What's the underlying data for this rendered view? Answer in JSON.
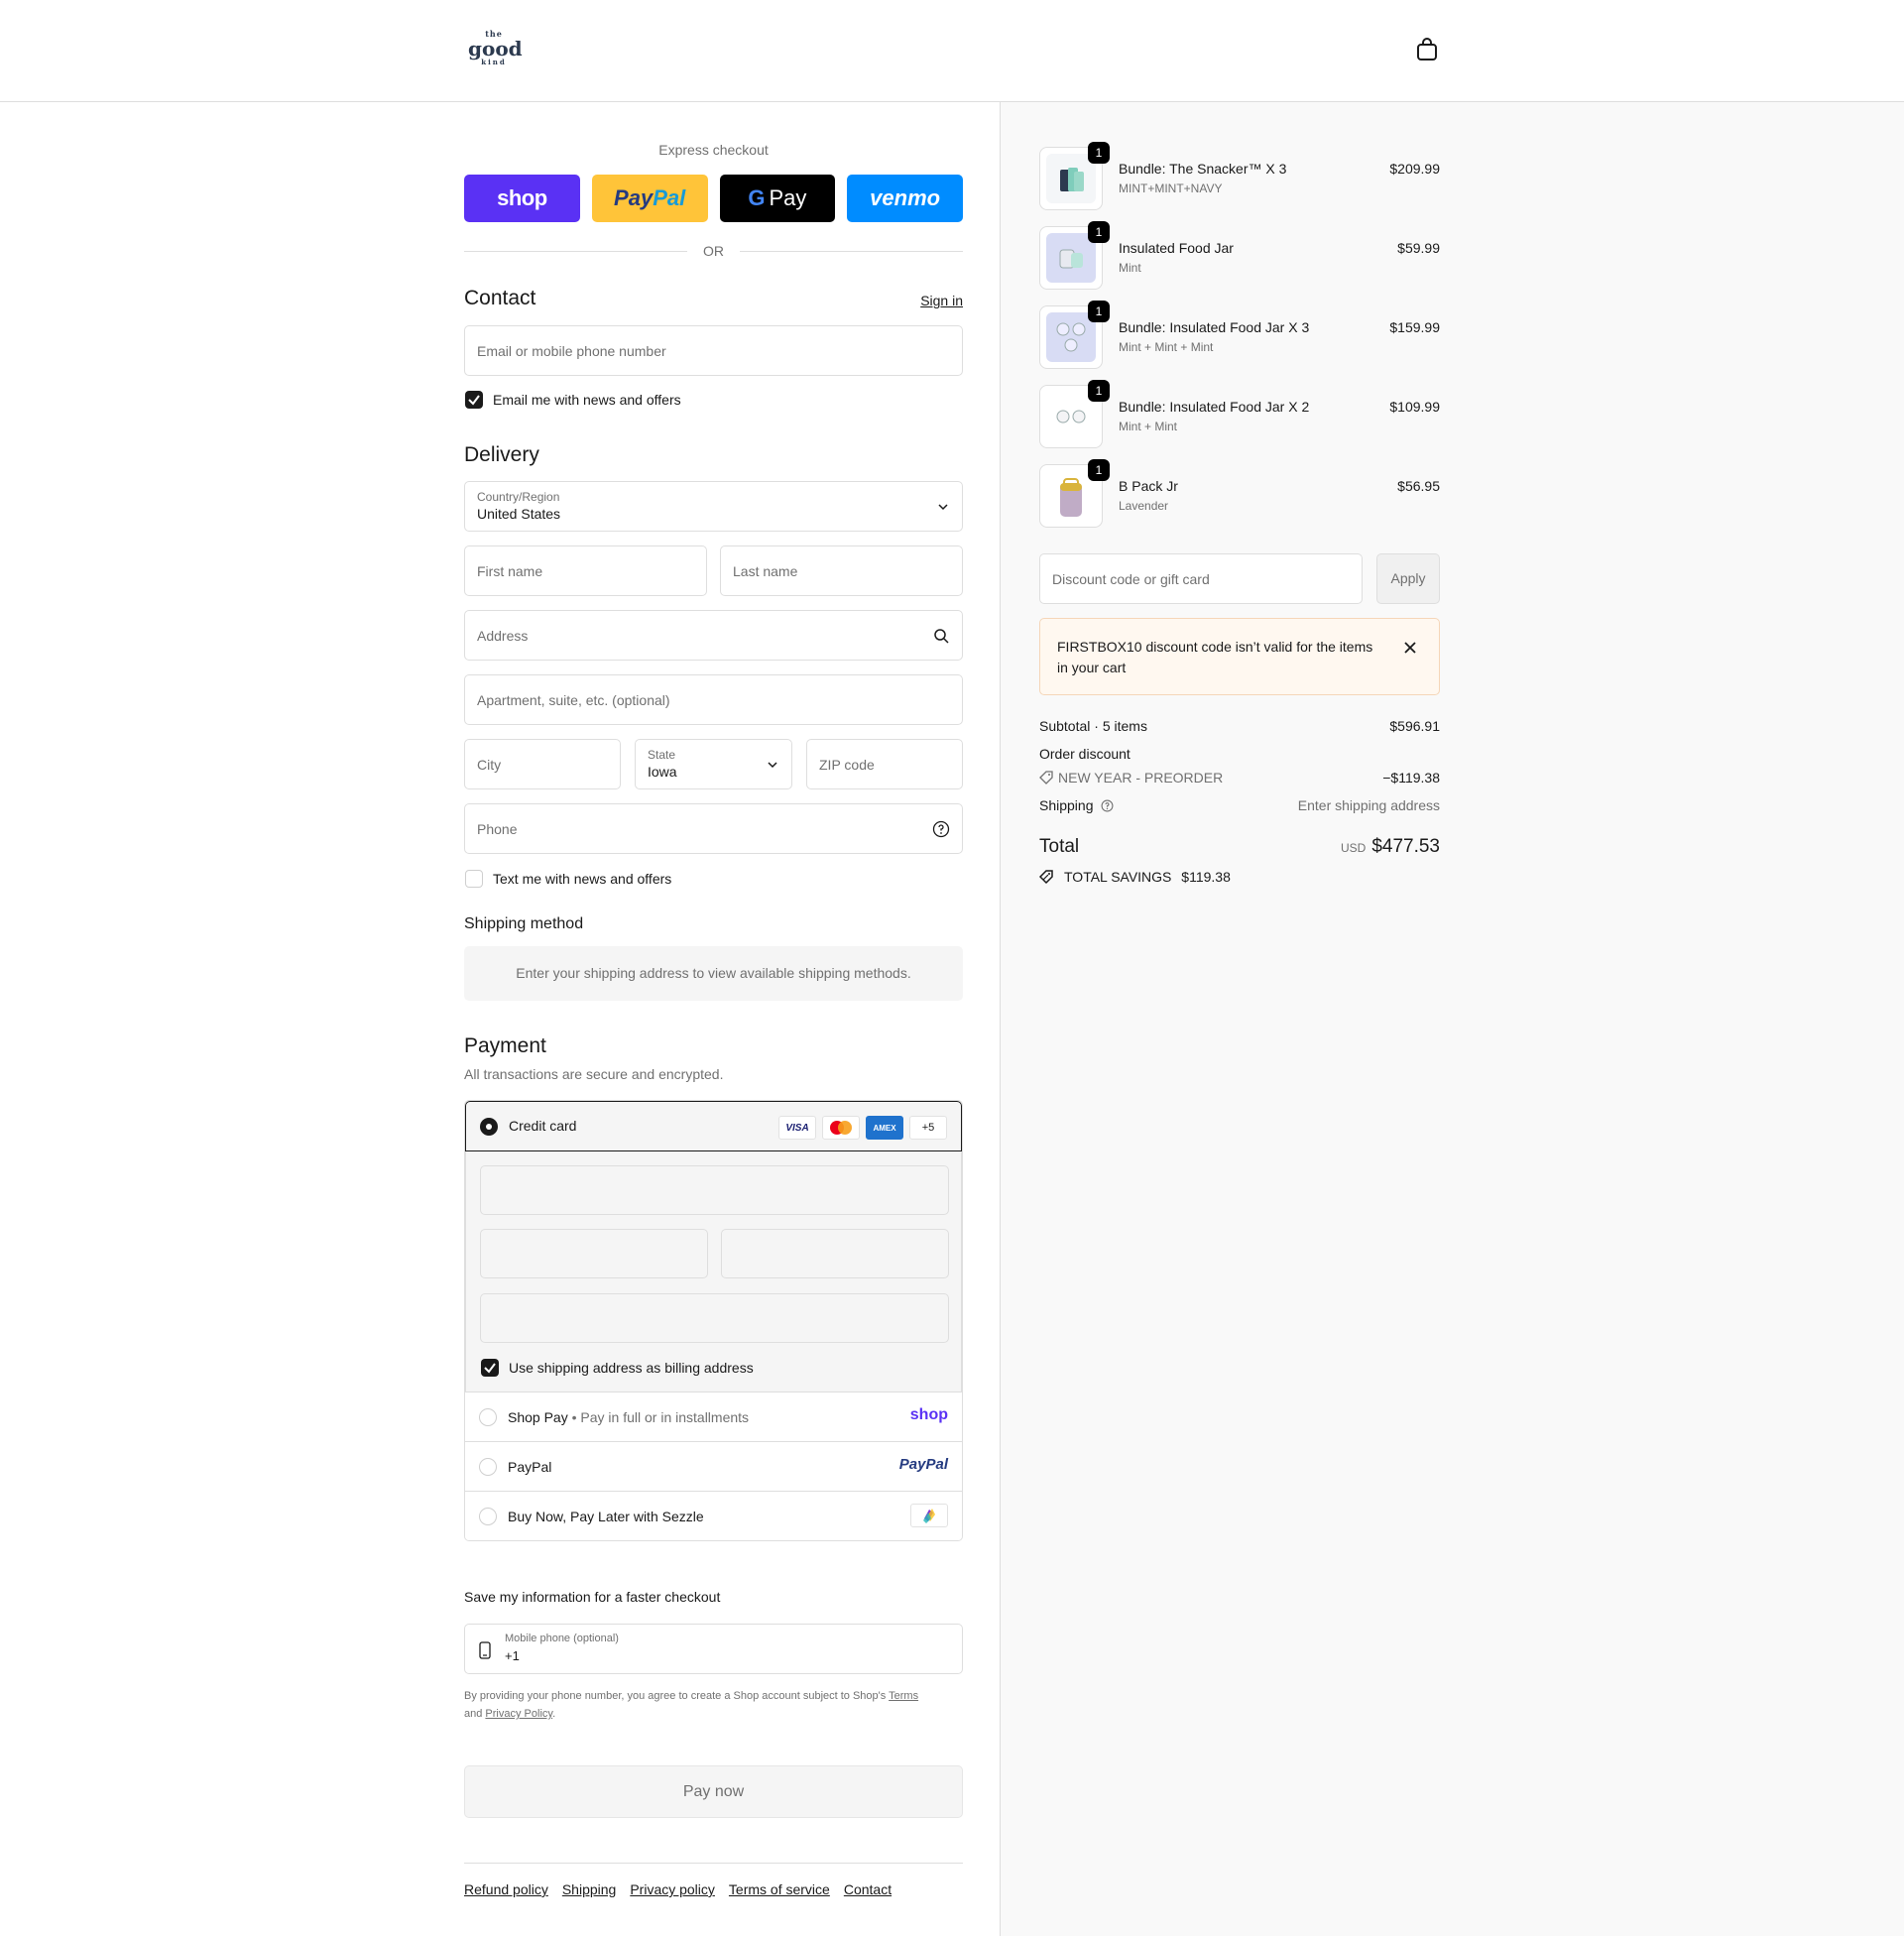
{
  "header": {
    "logo": {
      "top": "the",
      "mid": "good",
      "bot": "kind"
    },
    "cart_icon": "shopping-bag-icon"
  },
  "express": {
    "title": "Express checkout",
    "buttons": {
      "shop": "shop",
      "paypal_1": "Pay",
      "paypal_2": "Pal",
      "gpay_g": "G",
      "gpay": "Pay",
      "venmo": "venmo"
    },
    "or": "OR"
  },
  "contact": {
    "title": "Contact",
    "sign_in": "Sign in",
    "email_placeholder": "Email or mobile phone number",
    "news_checkbox": "Email me with news and offers",
    "news_checked": true
  },
  "delivery": {
    "title": "Delivery",
    "country_label": "Country/Region",
    "country_value": "United States",
    "first_name": "First name",
    "last_name": "Last name",
    "address": "Address",
    "apartment": "Apartment, suite, etc. (optional)",
    "city": "City",
    "state_label": "State",
    "state_value": "Iowa",
    "zip": "ZIP code",
    "phone": "Phone",
    "text_checkbox": "Text me with news and offers",
    "text_checked": false
  },
  "shipping_method": {
    "title": "Shipping method",
    "message": "Enter your shipping address to view available shipping methods."
  },
  "payment": {
    "title": "Payment",
    "subtitle": "All transactions are secure and encrypted.",
    "credit_card": "Credit card",
    "cards": {
      "visa": "VISA",
      "amex": "AMEX",
      "more": "+5"
    },
    "billing_checkbox": "Use shipping address as billing address",
    "billing_checked": true,
    "shop_pay": "Shop Pay",
    "shop_pay_sub": "Pay in full or in installments",
    "shop_pay_brand": "shop",
    "paypal": "PayPal",
    "paypal_brand": "PayPal",
    "sezzle": "Buy Now, Pay Later with Sezzle"
  },
  "save_info": {
    "title": "Save my information for a faster checkout",
    "mobile_label": "Mobile phone (optional)",
    "mobile_value": "+1",
    "legal_1": "By providing your phone number, you agree to create a Shop account subject to Shop's ",
    "terms": "Terms",
    "legal_2": "and ",
    "privacy": "Privacy Policy",
    "legal_3": "."
  },
  "pay_now": "Pay now",
  "footer": {
    "links": [
      "Refund policy",
      "Shipping",
      "Privacy policy",
      "Terms of service",
      "Contact"
    ]
  },
  "cart": {
    "items": [
      {
        "name": "Bundle: The Snacker™ X 3",
        "variant": "MINT+MINT+NAVY",
        "price": "$209.99",
        "qty": "1"
      },
      {
        "name": "Insulated Food Jar",
        "variant": "Mint",
        "price": "$59.99",
        "qty": "1"
      },
      {
        "name": "Bundle: Insulated Food Jar X 3",
        "variant": "Mint + Mint + Mint",
        "price": "$159.99",
        "qty": "1"
      },
      {
        "name": "Bundle: Insulated Food Jar X 2",
        "variant": "Mint + Mint",
        "price": "$109.99",
        "qty": "1"
      },
      {
        "name": "B Pack Jr",
        "variant": "Lavender",
        "price": "$56.95",
        "qty": "1"
      }
    ],
    "discount_placeholder": "Discount code or gift card",
    "apply": "Apply",
    "alert": "FIRSTBOX10 discount code isn’t valid for the items in your cart",
    "subtotal_label": "Subtotal · 5 items",
    "subtotal": "$596.91",
    "order_discount_label": "Order discount",
    "discount_code": "NEW YEAR - PREORDER",
    "discount_amount": "−$119.38",
    "shipping_label": "Shipping",
    "shipping_value": "Enter shipping address",
    "total_label": "Total",
    "currency": "USD",
    "total": "$477.53",
    "savings_label": "TOTAL SAVINGS",
    "savings": "$119.38"
  }
}
